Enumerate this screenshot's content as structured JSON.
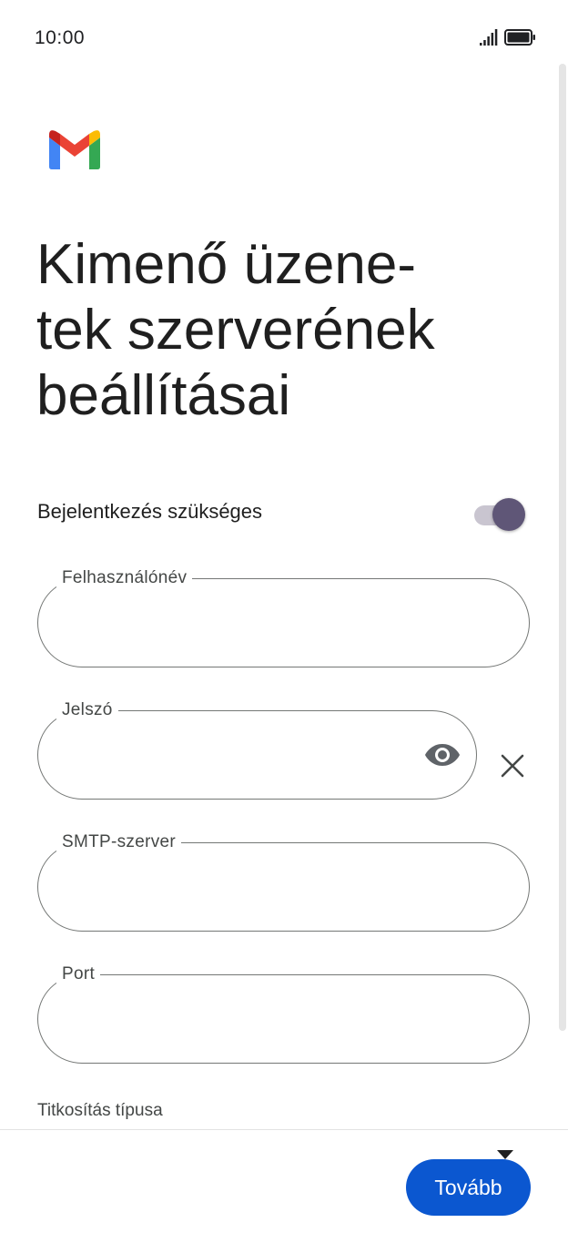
{
  "status_bar": {
    "time": "10:00"
  },
  "header": {
    "title": "Kimenő üzene-\ntek szerverének\nbeállításai"
  },
  "login_required": {
    "label": "Bejelentkezés szükséges",
    "enabled": true
  },
  "fields": {
    "username": {
      "label": "Felhasználónév",
      "value": ""
    },
    "password": {
      "label": "Jelszó",
      "value": ""
    },
    "smtp_server": {
      "label": "SMTP-szerver",
      "value": ""
    },
    "port": {
      "label": "Port",
      "value": ""
    }
  },
  "encryption": {
    "label": "Titkosítás típusa"
  },
  "footer": {
    "next_label": "Tovább"
  },
  "colors": {
    "primary": "#0b57d0",
    "toggle_thumb": "#5f5677",
    "toggle_track": "#c9c5d0",
    "outline": "#747775"
  },
  "icons": [
    "gmail-logo",
    "signal-icon",
    "battery-icon",
    "eye-icon",
    "close-icon",
    "dropdown-arrow-icon"
  ]
}
